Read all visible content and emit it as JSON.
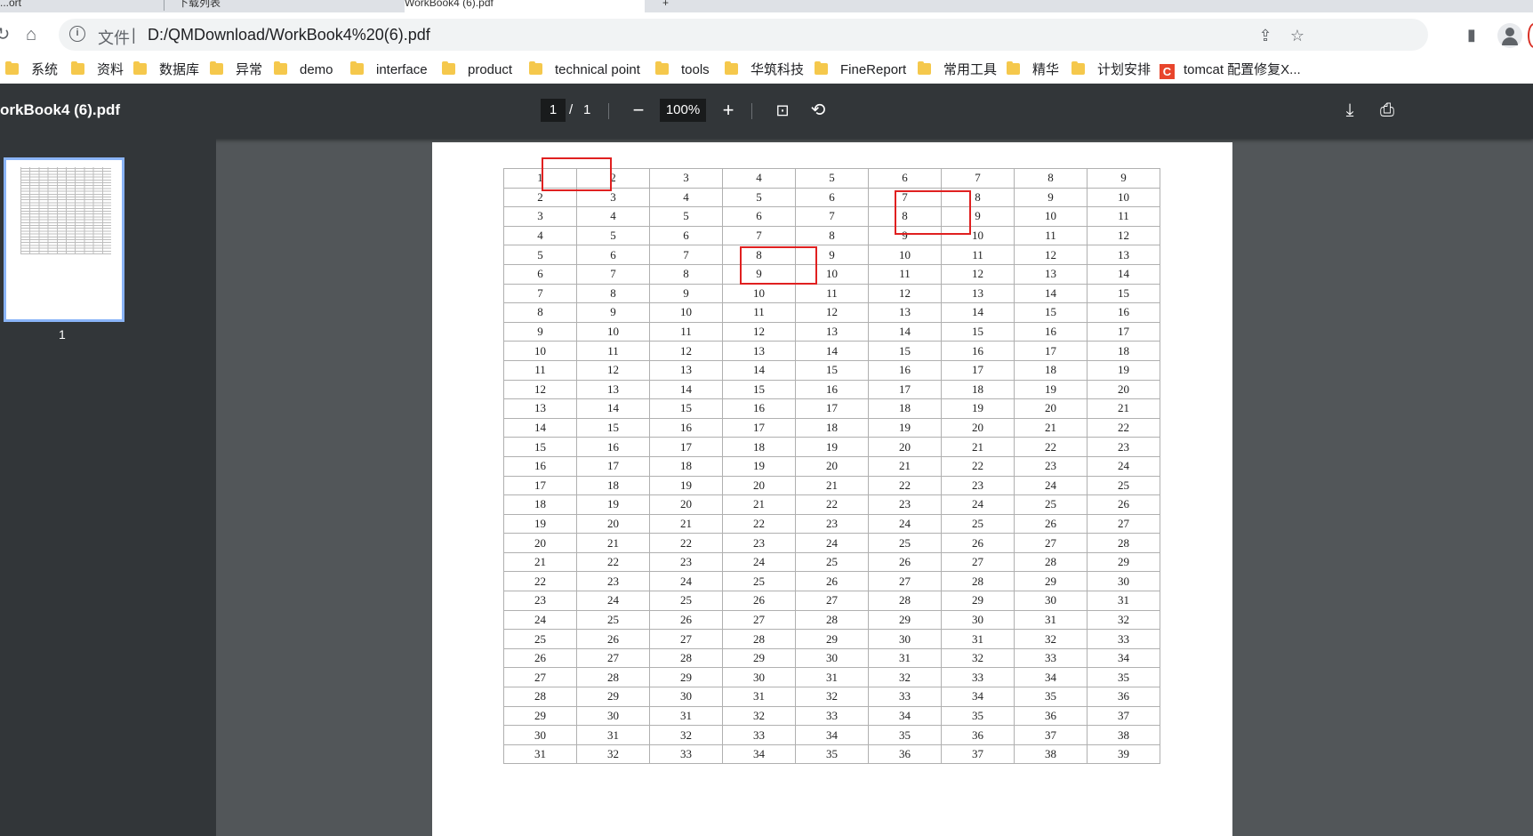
{
  "tabs": [
    {
      "label": "...ort"
    },
    {
      "label": "下载列表"
    },
    {
      "label": "WorkBook4 (6).pdf"
    },
    {
      "label": "+"
    }
  ],
  "address_bar": {
    "scheme_label": "文件",
    "separator": "|",
    "url": "D:/QMDownload/WorkBook4%20(6).pdf"
  },
  "icons": {
    "reload": "reload-icon",
    "home": "home-icon",
    "info": "info-icon",
    "share": "share-icon",
    "star": "star-icon",
    "sidepanel": "side-panel-icon",
    "profile": "profile-icon"
  },
  "bookmarks": [
    {
      "label": "系统"
    },
    {
      "label": "资料"
    },
    {
      "label": "数据库"
    },
    {
      "label": "异常"
    },
    {
      "label": "demo"
    },
    {
      "label": "interface"
    },
    {
      "label": "product"
    },
    {
      "label": "technical point"
    },
    {
      "label": "tools"
    },
    {
      "label": "华筑科技"
    },
    {
      "label": "FineReport"
    },
    {
      "label": "常用工具"
    },
    {
      "label": "精华"
    },
    {
      "label": "计划安排"
    },
    {
      "label": "tomcat 配置修复X..."
    }
  ],
  "pdf_toolbar": {
    "title": "orkBook4 (6).pdf",
    "page_current": "1",
    "page_sep": "/",
    "page_total": "1",
    "zoom": "100%"
  },
  "sidebar": {
    "thumbnail_label": "1"
  },
  "table": {
    "rows": [
      [
        1,
        2,
        3,
        4,
        5,
        6,
        7,
        8,
        9
      ],
      [
        2,
        3,
        4,
        5,
        6,
        7,
        8,
        9,
        10
      ],
      [
        3,
        4,
        5,
        6,
        7,
        8,
        9,
        10,
        11
      ],
      [
        4,
        5,
        6,
        7,
        8,
        9,
        10,
        11,
        12
      ],
      [
        5,
        6,
        7,
        8,
        9,
        10,
        11,
        12,
        13
      ],
      [
        6,
        7,
        8,
        9,
        10,
        11,
        12,
        13,
        14
      ],
      [
        7,
        8,
        9,
        10,
        11,
        12,
        13,
        14,
        15
      ],
      [
        8,
        9,
        10,
        11,
        12,
        13,
        14,
        15,
        16
      ],
      [
        9,
        10,
        11,
        12,
        13,
        14,
        15,
        16,
        17
      ],
      [
        10,
        11,
        12,
        13,
        14,
        15,
        16,
        17,
        18
      ],
      [
        11,
        12,
        13,
        14,
        15,
        16,
        17,
        18,
        19
      ],
      [
        12,
        13,
        14,
        15,
        16,
        17,
        18,
        19,
        20
      ],
      [
        13,
        14,
        15,
        16,
        17,
        18,
        19,
        20,
        21
      ],
      [
        14,
        15,
        16,
        17,
        18,
        19,
        20,
        21,
        22
      ],
      [
        15,
        16,
        17,
        18,
        19,
        20,
        21,
        22,
        23
      ],
      [
        16,
        17,
        18,
        19,
        20,
        21,
        22,
        23,
        24
      ],
      [
        17,
        18,
        19,
        20,
        21,
        22,
        23,
        24,
        25
      ],
      [
        18,
        19,
        20,
        21,
        22,
        23,
        24,
        25,
        26
      ],
      [
        19,
        20,
        21,
        22,
        23,
        24,
        25,
        26,
        27
      ],
      [
        20,
        21,
        22,
        23,
        24,
        25,
        26,
        27,
        28
      ],
      [
        21,
        22,
        23,
        24,
        25,
        26,
        27,
        28,
        29
      ],
      [
        22,
        23,
        24,
        25,
        26,
        27,
        28,
        29,
        30
      ],
      [
        23,
        24,
        25,
        26,
        27,
        28,
        29,
        30,
        31
      ],
      [
        24,
        25,
        26,
        27,
        28,
        29,
        30,
        31,
        32
      ],
      [
        25,
        26,
        27,
        28,
        29,
        30,
        31,
        32,
        33
      ],
      [
        26,
        27,
        28,
        29,
        30,
        31,
        32,
        33,
        34
      ],
      [
        27,
        28,
        29,
        30,
        31,
        32,
        33,
        34,
        35
      ],
      [
        28,
        29,
        30,
        31,
        32,
        33,
        34,
        35,
        36
      ],
      [
        29,
        30,
        31,
        32,
        33,
        34,
        35,
        36,
        37
      ],
      [
        30,
        31,
        32,
        33,
        34,
        35,
        36,
        37,
        38
      ],
      [
        31,
        32,
        33,
        34,
        35,
        36,
        37,
        38,
        39
      ]
    ]
  },
  "colors": {
    "highlight": "#e02020",
    "pdf_toolbar_bg": "#323639",
    "viewer_bg": "#525659"
  }
}
